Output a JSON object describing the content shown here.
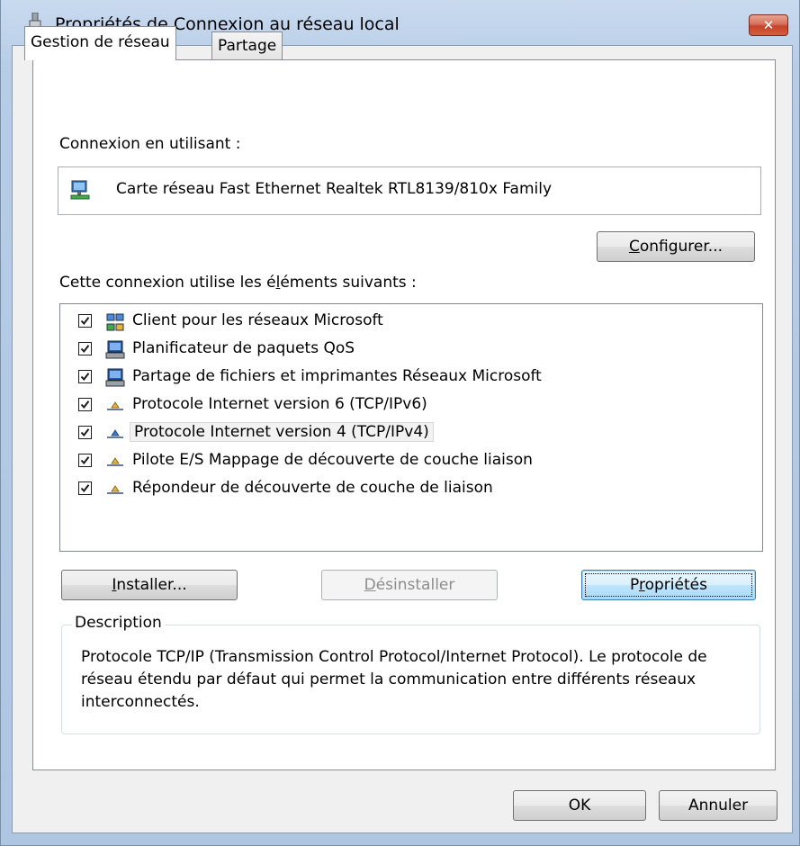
{
  "window": {
    "title": "Propriétés de Connexion au réseau local",
    "close_label": "✕"
  },
  "tabs": [
    {
      "label": "Gestion de réseau",
      "active": true
    },
    {
      "label": "Partage",
      "active": false
    }
  ],
  "connection": {
    "label": "Connexion en utilisant :",
    "adapter": "Carte réseau Fast Ethernet Realtek RTL8139/810x Family"
  },
  "buttons": {
    "configure": {
      "pre": "",
      "accel": "C",
      "post": "onfigurer..."
    },
    "install": {
      "pre": "",
      "accel": "I",
      "post": "nstaller..."
    },
    "uninstall": {
      "pre": "",
      "accel": "D",
      "post": "ésinstaller"
    },
    "properties": {
      "pre": "P",
      "accel": "r",
      "post": "opriétés"
    },
    "ok": "OK",
    "cancel": "Annuler"
  },
  "items_label": {
    "pre": "Cette connexion utilise les é",
    "accel": "l",
    "post": "éments suivants :"
  },
  "items": [
    {
      "label": "Client pour les réseaux Microsoft",
      "checked": true,
      "icon": "network-client-icon"
    },
    {
      "label": "Planificateur de paquets QoS",
      "checked": true,
      "icon": "computer-service-icon"
    },
    {
      "label": "Partage de fichiers et imprimantes Réseaux Microsoft",
      "checked": true,
      "icon": "computer-service-icon"
    },
    {
      "label": "Protocole Internet version 6 (TCP/IPv6)",
      "checked": true,
      "icon": "protocol-icon"
    },
    {
      "label": "Protocole Internet version 4 (TCP/IPv4)",
      "checked": true,
      "icon": "protocol-icon",
      "selected": true
    },
    {
      "label": "Pilote E/S Mappage de découverte de couche liaison",
      "checked": true,
      "icon": "protocol-icon"
    },
    {
      "label": "Répondeur de découverte de couche de liaison",
      "checked": true,
      "icon": "protocol-icon"
    }
  ],
  "description": {
    "legend": "Description",
    "text": "Protocole TCP/IP (Transmission Control Protocol/Internet Protocol). Le protocole de réseau étendu par défaut qui permet la communication entre différents réseaux interconnectés."
  },
  "colors": {
    "frame": "#b7cde6",
    "close": "#c7432a",
    "default_button": "#3c7fb1"
  }
}
